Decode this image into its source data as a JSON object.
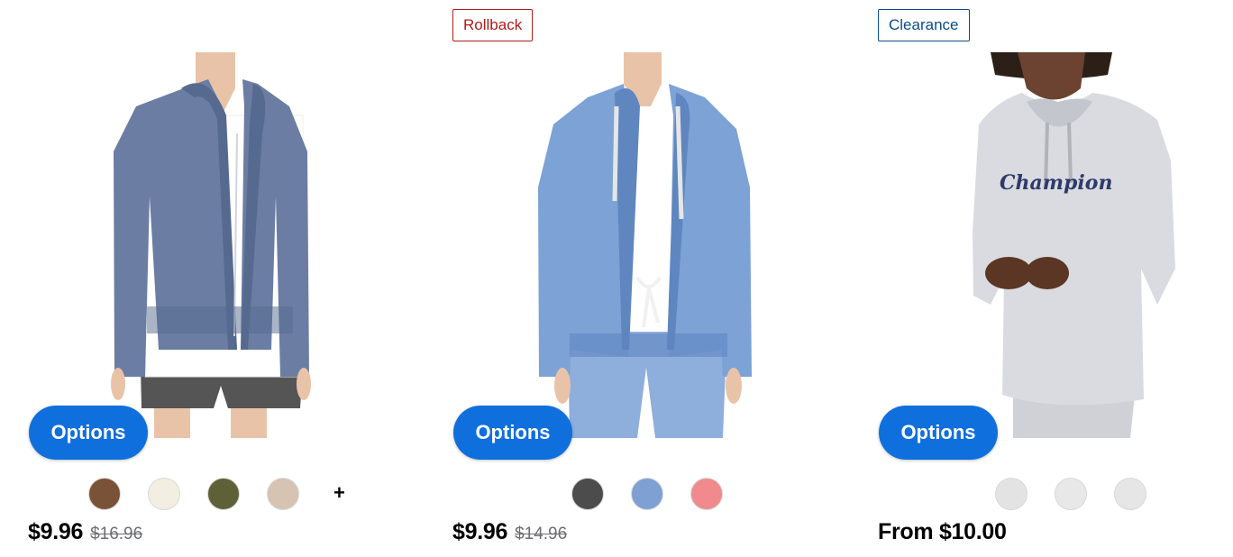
{
  "products": [
    {
      "badge": "",
      "options_label": "Options",
      "swatches": [
        "#7a5237",
        "#f2eee2",
        "#5e6137",
        "#d6c3b1"
      ],
      "more_label": "+",
      "price": "$9.96",
      "was_price": "$16.96",
      "colors": {
        "garment": "#6b7da3",
        "garment_dark": "#56698f",
        "top": "#ffffff",
        "bottom": "#555555"
      }
    },
    {
      "badge": "Rollback",
      "options_label": "Options",
      "swatches": [
        "#4c4c4c",
        "#7ea0d2",
        "#f08a8c"
      ],
      "more_label": "",
      "price": "$9.96",
      "was_price": "$14.96",
      "colors": {
        "garment": "#7ca2d6",
        "garment_dark": "#5f86bf",
        "top": "#ffffff",
        "bottom": "#8eaedb"
      }
    },
    {
      "badge": "Clearance",
      "options_label": "Options",
      "swatches": [
        "#e3e3e3",
        "#e8e8e8",
        "#e6e6e6"
      ],
      "more_label": "",
      "price": "From $10.00",
      "was_price": "",
      "logo_text": "Champion",
      "colors": {
        "garment": "#d9dbe0",
        "garment_dark": "#c3c6cc",
        "top": "#d9dbe0",
        "bottom": "#cfd1d6"
      }
    }
  ],
  "colors": {
    "button": "#0f6fdd",
    "rollback": "#b01b1b",
    "clearance": "#0b4c8c"
  }
}
